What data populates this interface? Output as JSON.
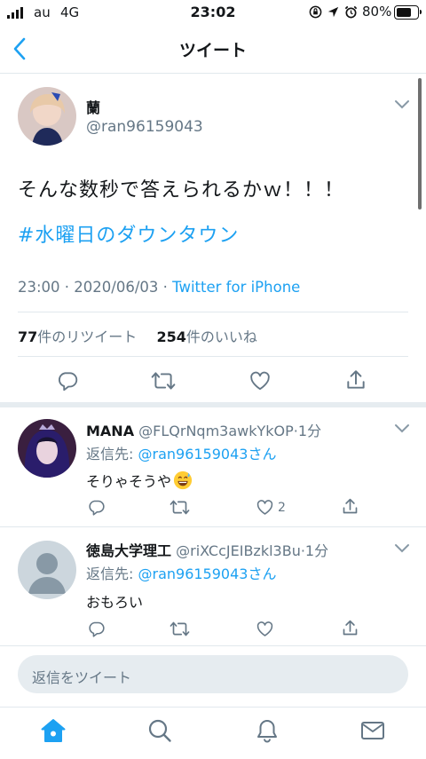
{
  "status_bar": {
    "carrier": "au",
    "network": "4G",
    "time": "23:02",
    "battery": "80%",
    "battery_level": 0.8
  },
  "nav": {
    "back_icon": "chevron-left-icon",
    "title": "ツイート"
  },
  "main_tweet": {
    "display_name": "蘭",
    "handle": "@ran96159043",
    "text": "そんな数秒で答えられるかｗ！！！",
    "hashtag": "#水曜日のダウンタウン",
    "time": "23:00 · 2020/06/03 · ",
    "client": "Twitter for iPhone",
    "retweet_count": "77",
    "retweet_label": "件のリツイート",
    "like_count": "254",
    "like_label": "件のいいね"
  },
  "replies": [
    {
      "display_name": "MANA",
      "handle": "@FLQrNqm3awkYkOP",
      "time": "1分",
      "reply_to_label": "返信先: ",
      "reply_to": "@ran96159043さん",
      "text": "そりゃそうや",
      "emoji": "grinning-sweat-emoji",
      "like_count": "2"
    },
    {
      "display_name": "徳島大学理工",
      "handle": "@riXCcJEIBzkl3Bu",
      "time": "1分",
      "reply_to_label": "返信先: ",
      "reply_to": "@ran96159043さん",
      "text": "おもろい",
      "like_count": ""
    }
  ],
  "compose": {
    "placeholder": "返信をツイート"
  },
  "tabbar": {
    "items": [
      "home-icon",
      "search-icon",
      "notifications-icon",
      "messages-icon"
    ]
  },
  "colors": {
    "accent": "#1da1f2",
    "secondary_text": "#657786",
    "divider": "#e1e8ed"
  }
}
